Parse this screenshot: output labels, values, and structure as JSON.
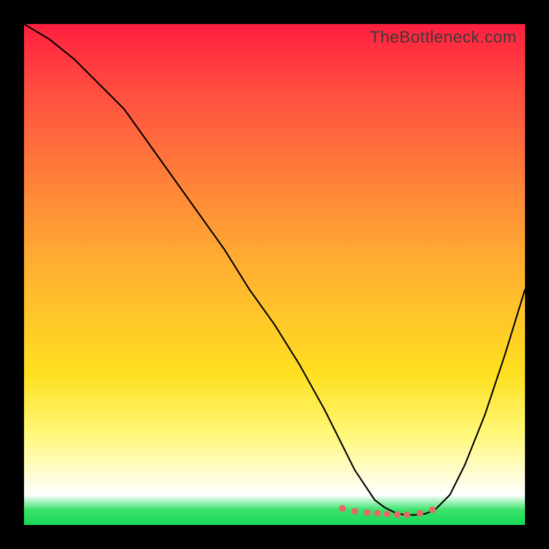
{
  "watermark": "TheBottleneck.com",
  "chart_data": {
    "type": "line",
    "title": "",
    "xlabel": "",
    "ylabel": "",
    "xlim": [
      0,
      100
    ],
    "ylim": [
      0,
      100
    ],
    "series": [
      {
        "name": "curve",
        "x": [
          0,
          5,
          10,
          15,
          20,
          25,
          30,
          35,
          40,
          45,
          50,
          55,
          60,
          62,
          64,
          66,
          68,
          70,
          72,
          74,
          76,
          78,
          80,
          82,
          85,
          88,
          92,
          96,
          100
        ],
        "y": [
          100,
          97,
          93,
          88,
          83,
          76,
          69,
          62,
          55,
          47,
          40,
          32,
          23,
          19,
          15,
          11,
          8,
          5,
          3.5,
          2.5,
          2.0,
          2.0,
          2.2,
          3.0,
          6,
          12,
          22,
          34,
          47
        ]
      }
    ],
    "markers": {
      "name": "highlight-dots",
      "color": "#e46a6a",
      "x": [
        63.5,
        66,
        68.5,
        70.5,
        72.5,
        74.5,
        76.5,
        79,
        81.5
      ],
      "y": [
        3.3,
        2.8,
        2.5,
        2.3,
        2.2,
        2.1,
        2.1,
        2.3,
        3.0
      ]
    }
  }
}
